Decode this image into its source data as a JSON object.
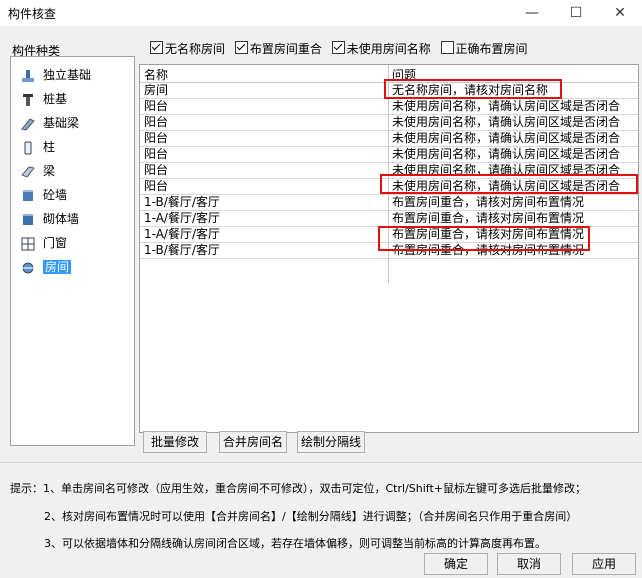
{
  "window": {
    "title": "构件核查",
    "minimize": "—",
    "maximize": "☐",
    "close": "✕"
  },
  "left_panel": {
    "label": "构件种类",
    "items": [
      {
        "label": "独立基础",
        "icon": "isolated-footing-icon"
      },
      {
        "label": "桩基",
        "icon": "pile-icon"
      },
      {
        "label": "基础梁",
        "icon": "foundation-beam-icon"
      },
      {
        "label": "柱",
        "icon": "column-icon"
      },
      {
        "label": "梁",
        "icon": "beam-icon"
      },
      {
        "label": "砼墙",
        "icon": "concrete-wall-icon"
      },
      {
        "label": "砌体墙",
        "icon": "masonry-wall-icon"
      },
      {
        "label": "门窗",
        "icon": "door-window-icon"
      },
      {
        "label": "房间",
        "icon": "room-icon",
        "selected": true
      }
    ]
  },
  "filters": [
    {
      "label": "无名称房间",
      "checked": true
    },
    {
      "label": "布置房间重合",
      "checked": true
    },
    {
      "label": "未使用房间名称",
      "checked": true
    },
    {
      "label": "正确布置房间",
      "checked": false
    }
  ],
  "table": {
    "columns": [
      "名称",
      "问题"
    ],
    "rows": [
      [
        "房间",
        "无名称房间，请核对房间名称"
      ],
      [
        "阳台",
        "未使用房间名称，请确认房间区域是否闭合"
      ],
      [
        "阳台",
        "未使用房间名称，请确认房间区域是否闭合"
      ],
      [
        "阳台",
        "未使用房间名称，请确认房间区域是否闭合"
      ],
      [
        "阳台",
        "未使用房间名称，请确认房间区域是否闭合"
      ],
      [
        "阳台",
        "未使用房间名称，请确认房间区域是否闭合"
      ],
      [
        "阳台",
        "未使用房间名称，请确认房间区域是否闭合"
      ],
      [
        "1-B/餐厅/客厅",
        "布置房间重合，请核对房间布置情况"
      ],
      [
        "1-A/餐厅/客厅",
        "布置房间重合，请核对房间布置情况"
      ],
      [
        "1-A/餐厅/客厅",
        "布置房间重合，请核对房间布置情况"
      ],
      [
        "1-B/餐厅/客厅",
        "布置房间重合，请核对房间布置情况"
      ]
    ]
  },
  "action_buttons": {
    "batch_edit": "批量修改",
    "merge_room": "合并房间名",
    "draw_divider": "绘制分隔线"
  },
  "hints": [
    "提示：1、单击房间名可修改（应用生效，重合房间不可修改），双击可定位，Ctrl/Shift+鼠标左键可多选后批量修改；",
    "2、核对房间布置情况时可以使用【合并房间名】/【绘制分隔线】进行调整；（合并房间名只作用于重合房间）",
    "3、可以依据墙体和分隔线确认房间闭合区域，若存在墙体偏移，则可调整当前标高的计算高度再布置。"
  ],
  "footer_buttons": {
    "ok": "确定",
    "cancel": "取消",
    "apply": "应用"
  },
  "highlight_color": "#e01010",
  "selection_color": "#3399ff"
}
